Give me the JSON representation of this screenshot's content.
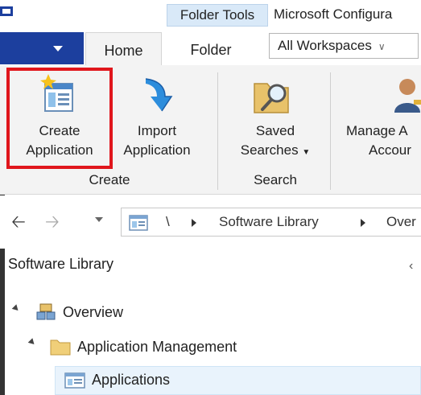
{
  "titlebar": {
    "context_tab": "Folder Tools",
    "title": "Microsoft Configura"
  },
  "tabs": {
    "home": "Home",
    "folder": "Folder"
  },
  "workspace_select": {
    "value": "All Workspaces"
  },
  "ribbon": {
    "create_group": {
      "label": "Create",
      "create_application": {
        "line1": "Create",
        "line2": "Application"
      },
      "import_application": {
        "line1": "Import",
        "line2": "Application"
      }
    },
    "search_group": {
      "label": "Search",
      "saved_searches": {
        "line1": "Saved",
        "line2": "Searches"
      }
    },
    "manage": {
      "line1": "Manage A",
      "line2": "Accour"
    }
  },
  "address": {
    "root": "\\",
    "crumb1": "Software Library",
    "crumb2": "Over"
  },
  "nav_pane": {
    "header": "Software Library",
    "tree": {
      "overview": "Overview",
      "application_management": "Application Management",
      "applications": "Applications"
    }
  },
  "colors": {
    "file_tab": "#1c3f9e",
    "highlight": "#e0161c",
    "context_tab": "#d9e9f8"
  }
}
